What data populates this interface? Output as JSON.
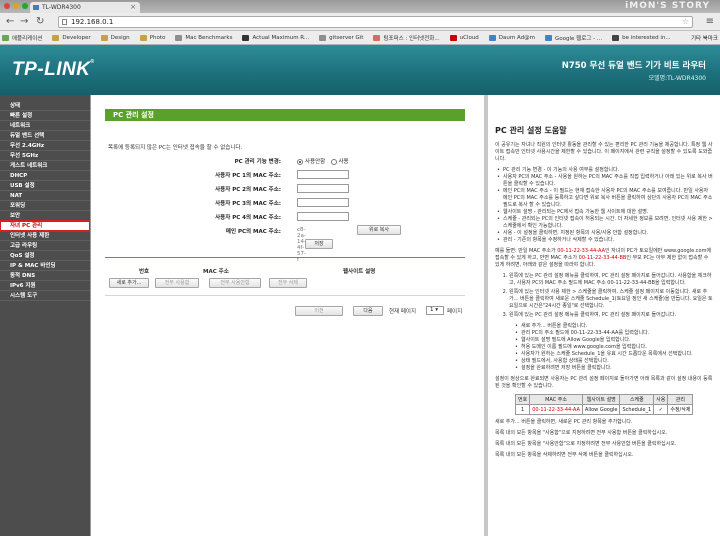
{
  "browser": {
    "tab_title": "TL-WDR4300",
    "watermark": "iMON'S STORY",
    "url": "192.168.0.1",
    "bookmarks": [
      "애플리케이션",
      "Developer",
      "Design",
      "Photo",
      "Mac Benchmarks",
      "Actual Maximum R...",
      "gitserver Git",
      "팀포퍼스 : 인터넷전화...",
      "uCloud",
      "Daum Ad@m",
      "Google 웹로그 - ...",
      "be interested in..."
    ],
    "bookmarks_right": "기타 북마크"
  },
  "header": {
    "logo": "TP-LINK",
    "product": "N750 무선 듀얼 밴드 기가 비트 라우터",
    "model": "모델명:TL-WDR4300"
  },
  "sidebar": {
    "items": [
      "상태",
      "빠른 설정",
      "네트워크",
      "듀얼 밴드 선택",
      "무선 2.4GHz",
      "무선 5GHz",
      "게스트 네트워크",
      "DHCP",
      "USB 설정",
      "NAT",
      "포워딩",
      "보안",
      "자녀 PC 관리",
      "인터넷 사용 제한",
      "고급 라우팅",
      "QoS 설정",
      "IP & MAC 바인딩",
      "동적 DNS",
      "IPv6 지원",
      "시스템 도구"
    ],
    "active": "자녀 PC 관리"
  },
  "main": {
    "title": "PC 관리 설정",
    "hint": "목록에 등록되지 않은 PC는 인터넷 접속을 할 수 없습니다.",
    "control_label": "PC 관리 기능 변경:",
    "control_options": [
      "사용안함",
      "사용"
    ],
    "pc_fields": [
      {
        "label": "사용자 PC 1의 MAC 주소:",
        "value": ""
      },
      {
        "label": "사용자 PC 2의 MAC 주소:",
        "value": ""
      },
      {
        "label": "사용자 PC 3의 MAC 주소:",
        "value": ""
      },
      {
        "label": "사용자 PC 4의 MAC 주소:",
        "value": ""
      }
    ],
    "current_mac_label": "메인 PC의 MAC 주소:",
    "current_mac_value": "c8-2a-14-4f-57-f",
    "copy_button": "위로 복사",
    "save_button": "저장",
    "table_headers": [
      "번호",
      "MAC 주소",
      "웹사이트 설명"
    ],
    "table_buttons": [
      "새로 추가...",
      "전부 사용함",
      "전부 사용안함",
      "전부 삭제"
    ],
    "prev_button": "이전",
    "next_button": "다음",
    "page_label": "현재 페이지",
    "page_value": "1",
    "page_suffix": "페이지"
  },
  "help": {
    "title": "PC 관리 설정 도움말",
    "intro": "이 공유기는 자녀나 직원의 인터넷 활동을 관리할 수 있는 편리한 PC 관리 기능을 제공합니다. 특정 웹 사이트 접속만 인터넷 사용시간을 제한할 수 있습니다. 이 페이지에서 관련 규칙을 설정할 수 있도록 도와줍니다.",
    "bullets": [
      "PC 관리 기능 변경 - 이 기능의 사용 여부를 설정합니다.",
      "사용자 PC의 MAC 주소 - 사용을 원하는 PC의 MAC 주소를 직접 입력하거나 아래 있는 위로 복사 버튼을 클릭할 수 있습니다.",
      "메인 PC의 MAC 주소 - 이 필드는 현재 접속한 사용자 PC의 MAC 주소를 보여줍니다. 만일 사용자 메인 PC의 MAC 주소를 등록하고 싶다면 위로 복사 버튼을 클릭하여 상단의 사용자 PC의 MAC 주소 필드로 복사 할 수 있습니다.",
      "웹사이트 설명 - 관리되는 PC에서 접속 가능한 웹 사이트에 대한 설명.",
      "스케줄 - 관리되는 PC의 인터넷 접속이 허용되는 시간. 더 자세한 정보를 보려면, 인터넷 사용 제한 > 스케줄에서 확인 가능합니다.",
      "사용 - 이 설정을 클릭하면, 지정된 항목의 사용/사용 안함 설정합니다.",
      "관리 - 기존의 항목을 수정하거나 삭제할 수 있습니다."
    ],
    "example_prefix": "예를 들면: 만일 MAC 주소가",
    "example_mac1": "00-11-22-33-44-AA",
    "example_mid": "인 자녀의 PC가 토요일에만 www.google.com에 접속할 수 있게 하고, 반면 MAC 주소가",
    "example_mac2": "00-11-22-33-44-BB",
    "example_suffix": "인 부모 PC는 아무 제한 없이 접속할 수 있게 하려면, 아래와 같은 설정을 따라야 합니다.",
    "steps": [
      "왼쪽에 있는 PC 관리 설정 메뉴를 클릭하여, PC 관리 설정 페이지로 들어갑니다. 사용함을 체크하고, 사용자 PC의 MAC 주소 필드에 MAC 주소 00-11-22-33-44-BB을 입력합니다.",
      "왼쪽에 있는 인터넷 사용 제한 > 스케줄을 클릭하여, 스케줄 설정 페이지로 이동합니다. 새로 추가... 버튼을 클릭하여 새로운 스케줄 Schedule_1(토요일 정인 새 스케줄)을 만듭니다. 요일은 토요일으로 시간은\"24시간 종일\"로 선택합니다.",
      "왼쪽에 있는 PC 관리 설정 메뉴를 클릭하여, PC 관리 설정 페이지로 들어갑니다."
    ],
    "sub_steps": [
      "새로 추가... 버튼을 클릭합니다.",
      "관리 PC의 주소 필드에 00-11-22-33-44-AA를 입력합니다.",
      "웹사이트 설명 필드에 Allow Google을 입력합니다.",
      "허용 도메인 이름 필드에 www.google.com을 입력합니다.",
      "사용자가 원하는 스케줄 Schedule_1을 유효 시간 드롭다운 목록에서 선택합니다.",
      "상태 필드에서, 사용함 상태를 선택합니다.",
      "설정을 완료하려면 저장 버튼을 클릭합니다."
    ],
    "after_text": "설정이 정상으로 완료되면 사용자는 PC 관리 설정 페이지로 돌아가면 아래 목록과 같이 설정 내용이 등록된 것을 확인할 수 있습니다.",
    "table": {
      "headers": [
        "번호",
        "MAC 주소",
        "웹사이트 설명",
        "스케줄",
        "사용",
        "관리"
      ],
      "row": [
        "1",
        "00-11-22-33-44-AA",
        "Allow Google",
        "Schedule_1",
        "✓",
        "수정/삭제"
      ]
    },
    "footer": [
      "새로 추가... 버튼을 클릭하면, 새로운 PC 관리 항목을 추가합니다.",
      "목록 내의 모든 항목을 \"사용함\"으로 지정하려면 전부 사용함 버튼을 클릭하십시오.",
      "목록 내의 모든 항목을 \"사용안함\"으로 지정하려면 전부 사용안함 버튼을 클릭하십시오.",
      "목록 내의 모든 항목을 삭제하려면 전부 삭제 버튼을 클릭하십시오."
    ]
  },
  "colors": {
    "banner": "#1c6f7b",
    "title_bar": "#5aa12b",
    "sidebar": "#4d4d4d",
    "active_outline": "#d61f1f",
    "example_red": "#cc0000"
  }
}
